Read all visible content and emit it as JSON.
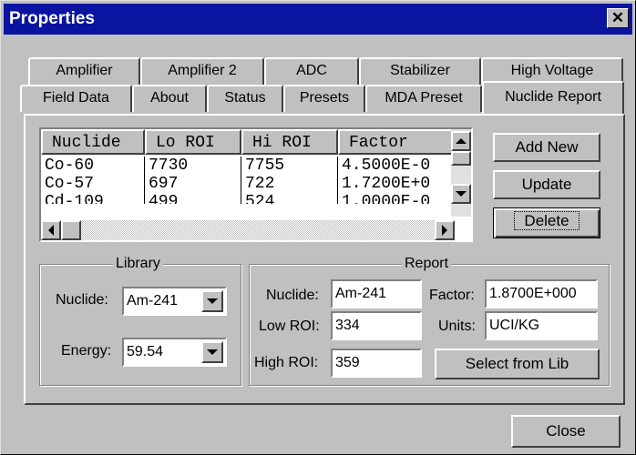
{
  "window": {
    "title": "Properties",
    "close_glyph": "✕"
  },
  "tabs_row1": [
    "Amplifier",
    "Amplifier 2",
    "ADC",
    "Stabilizer",
    "High Voltage"
  ],
  "tabs_row2": [
    "Field Data",
    "About",
    "Status",
    "Presets",
    "MDA Preset",
    "Nuclide Report"
  ],
  "active_tab": "Nuclide Report",
  "nuclide_list": {
    "columns": [
      "Nuclide",
      "Lo ROI",
      "Hi ROI",
      "Factor"
    ],
    "rows": [
      [
        "Co-60",
        "7730",
        "7755",
        "4.5000E-0"
      ],
      [
        "Co-57",
        "697",
        "722",
        "1.7200E+0"
      ],
      [
        "Cd-109",
        "499",
        "524",
        "1.0000E-0"
      ]
    ]
  },
  "buttons": {
    "add_new": "Add New",
    "update": "Update",
    "delete": "Delete",
    "select_from_lib": "Select from Lib",
    "close": "Close"
  },
  "library": {
    "legend": "Library",
    "nuclide_label": "Nuclide:",
    "nuclide_value": "Am-241",
    "energy_label": "Energy:",
    "energy_value": "59.54"
  },
  "report": {
    "legend": "Report",
    "nuclide_label": "Nuclide:",
    "nuclide_value": "Am-241",
    "low_roi_label": "Low ROI:",
    "low_roi_value": "334",
    "high_roi_label": "High ROI:",
    "high_roi_value": "359",
    "factor_label": "Factor:",
    "factor_value": "1.8700E+000",
    "units_label": "Units:",
    "units_value": "UCI/KG"
  },
  "colors": {
    "titlebar": "#0a14a0",
    "face": "#c0c0c0"
  }
}
